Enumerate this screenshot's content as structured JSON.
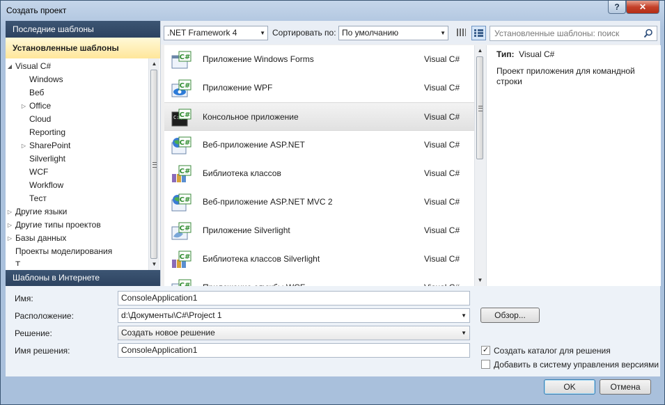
{
  "window": {
    "title": "Создать проект",
    "help": "?",
    "close": "✕"
  },
  "left_panel": {
    "recent": "Последние шаблоны",
    "installed": "Установленные шаблоны",
    "online": "Шаблоны в Интернете",
    "tree": [
      {
        "label": "Visual C#",
        "level": 0,
        "arrow": "◢"
      },
      {
        "label": "Windows",
        "level": 1,
        "arrow": ""
      },
      {
        "label": "Веб",
        "level": 1,
        "arrow": ""
      },
      {
        "label": "Office",
        "level": 1,
        "arrow": "▷"
      },
      {
        "label": "Cloud",
        "level": 1,
        "arrow": ""
      },
      {
        "label": "Reporting",
        "level": 1,
        "arrow": ""
      },
      {
        "label": "SharePoint",
        "level": 1,
        "arrow": "▷"
      },
      {
        "label": "Silverlight",
        "level": 1,
        "arrow": ""
      },
      {
        "label": "WCF",
        "level": 1,
        "arrow": ""
      },
      {
        "label": "Workflow",
        "level": 1,
        "arrow": ""
      },
      {
        "label": "Тест",
        "level": 1,
        "arrow": ""
      },
      {
        "label": "Другие языки",
        "level": 0,
        "arrow": "▷"
      },
      {
        "label": "Другие типы проектов",
        "level": 0,
        "arrow": "▷"
      },
      {
        "label": "Базы данных",
        "level": 0,
        "arrow": "▷"
      },
      {
        "label": "Проекты моделирования",
        "level": 0,
        "arrow": ""
      },
      {
        "label": "Т",
        "level": 0,
        "arrow": ""
      }
    ]
  },
  "toolbar": {
    "framework": ".NET Framework 4",
    "sort_label": "Сортировать по:",
    "sort_value": "По умолчанию",
    "search_placeholder": "Установленные шаблоны: поиск"
  },
  "templates": [
    {
      "name": "Приложение Windows Forms",
      "lang": "Visual C#",
      "icon": "winforms-icon"
    },
    {
      "name": "Приложение WPF",
      "lang": "Visual C#",
      "icon": "wpf-icon"
    },
    {
      "name": "Консольное приложение",
      "lang": "Visual C#",
      "icon": "console-icon",
      "selected": true
    },
    {
      "name": "Веб-приложение ASP.NET",
      "lang": "Visual C#",
      "icon": "web-icon"
    },
    {
      "name": "Библиотека классов",
      "lang": "Visual C#",
      "icon": "library-icon"
    },
    {
      "name": "Веб-приложение ASP.NET MVC 2",
      "lang": "Visual C#",
      "icon": "web-icon"
    },
    {
      "name": "Приложение Silverlight",
      "lang": "Visual C#",
      "icon": "silverlight-icon"
    },
    {
      "name": "Библиотека классов Silverlight",
      "lang": "Visual C#",
      "icon": "library-icon"
    },
    {
      "name": "Приложение службы WCF",
      "lang": "Visual C#",
      "icon": "wcf-icon"
    }
  ],
  "details": {
    "type_label": "Тип:",
    "type_value": "Visual C#",
    "description": "Проект приложения для командной строки"
  },
  "form": {
    "name_label": "Имя:",
    "name_value": "ConsoleApplication1",
    "location_label": "Расположение:",
    "location_value": "d:\\Документы\\C#\\Project 1",
    "browse_button": "Обзор...",
    "solution_label": "Решение:",
    "solution_value": "Создать новое решение",
    "solution_name_label": "Имя решения:",
    "solution_name_value": "ConsoleApplication1",
    "create_dir_label": "Создать каталог для решения",
    "create_dir_checked": true,
    "source_control_label": "Добавить в систему управления версиями",
    "source_control_checked": false
  },
  "buttons": {
    "ok": "OK",
    "cancel": "Отмена"
  },
  "colors": {
    "header_dark": "#2d4360",
    "selected_gold": "#ffe69a",
    "csharp_green": "#2e8b2e"
  }
}
